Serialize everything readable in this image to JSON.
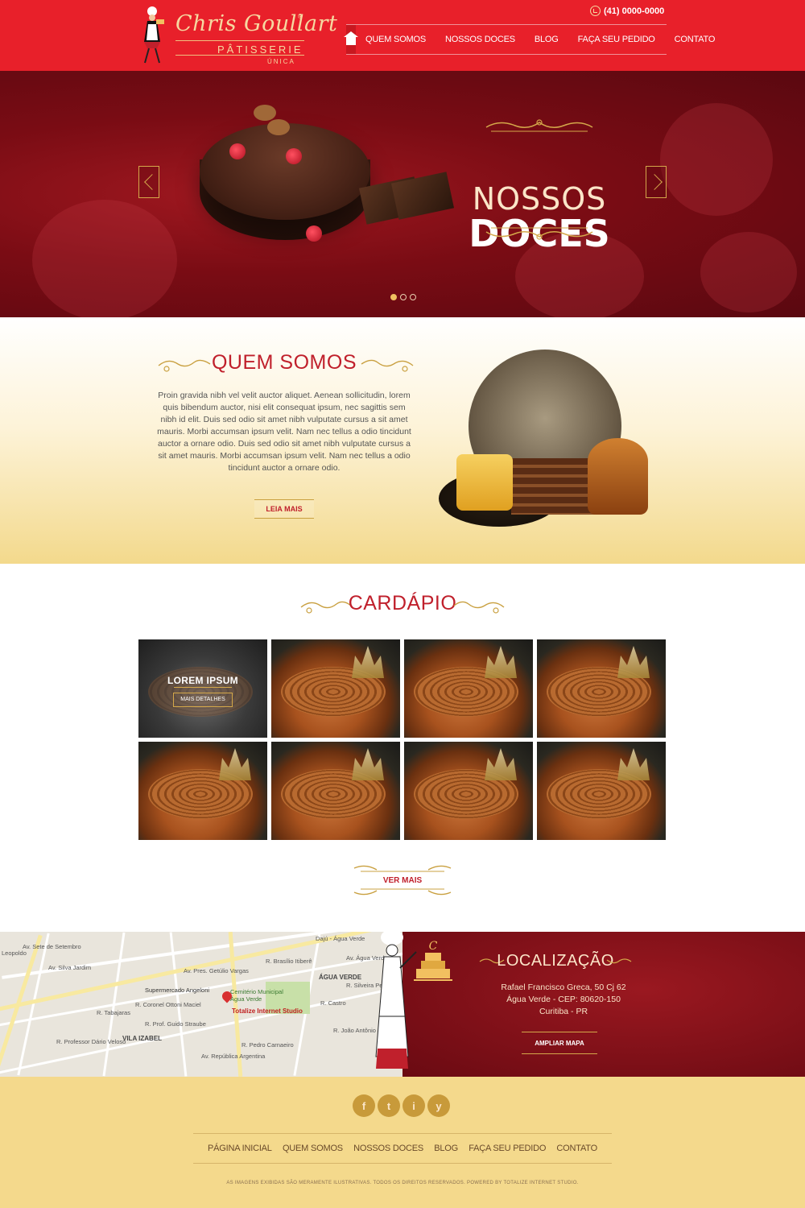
{
  "header": {
    "brand": "Chris Goullart",
    "brand_sub": "PÂTISSERIE",
    "brand_sub2": "ÚNICA",
    "registered": "®",
    "phone": "(41) 0000-0000",
    "nav": [
      "QUEM SOMOS",
      "NOSSOS DOCES",
      "BLOG",
      "FAÇA SEU PEDIDO",
      "CONTATO"
    ]
  },
  "hero": {
    "title_line1": "NOSSOS",
    "title_line2": "DOCES",
    "active_slide": 1,
    "slides": 3
  },
  "about": {
    "title": "QUEM SOMOS",
    "text": "Proin gravida nibh vel velit auctor aliquet. Aenean sollicitudin, lorem quis bibendum auctor, nisi elit consequat ipsum, nec sagittis sem nibh id elit. Duis sed odio sit amet nibh vulputate cursus a sit amet mauris. Morbi accumsan ipsum velit. Nam nec tellus a odio tincidunt auctor a ornare odio. Duis sed odio sit amet nibh vulputate cursus a sit amet mauris. Morbi accumsan ipsum velit. Nam nec tellus a odio tincidunt auctor a ornare odio.",
    "button": "LEIA MAIS"
  },
  "menu": {
    "title": "CARDÁPIO",
    "first_tile_label": "LOREM IPSUM",
    "first_tile_button": "MAIS DETALHES",
    "more_button": "VER MAIS"
  },
  "location": {
    "title": "LOCALIZAÇÃO",
    "address_line1": "Rafael Francisco Greca, 50 Cj 62",
    "address_line2": "Água Verde - CEP: 80620-150",
    "address_line3": "Curitiba - PR",
    "button": "AMPLIAR MAPA",
    "map_labels": {
      "l1": "Dajú - Água Verde",
      "l2": "R. Brasílio Itiberê",
      "l3": "ÁGUA VERDE",
      "l4": "Supermercado Angeloni",
      "l5": "Cemitério Municipal Água Verde",
      "l6": "Totalize Internet Studio",
      "l7": "VILA IZABEL",
      "l8": "Av. Sete de Setembro",
      "l9": "R. Coronel Ottoni Maciel",
      "l10": "R. Professor Dário Veloso",
      "l11": "Av. Pres. Getúlio Vargas",
      "l12": "R. Silveira Peixoto",
      "l13": "R. João Antônio Xavier",
      "l14": "R. Castro",
      "l15": "Av. Água Verde",
      "l16": "Leopoldo",
      "l17": "Av. Silva Jardim",
      "l18": "R. Tabajaras",
      "l19": "R. Prof. Guido Straube",
      "l20": "Av. República Argentina",
      "l21": "R. Pedro Carnaeiro"
    }
  },
  "footer": {
    "social": [
      "f",
      "t",
      "i",
      "y"
    ],
    "nav": [
      "PÁGINA INICIAL",
      "QUEM SOMOS",
      "NOSSOS DOCES",
      "BLOG",
      "FAÇA SEU PEDIDO",
      "CONTATO"
    ],
    "copyright": "AS IMAGENS EXIBIDAS SÃO MERAMENTE ILUSTRATIVAS. TODOS OS DIREITOS RESERVADOS. POWERED BY TOTALIZE INTERNET STUDIO."
  },
  "colors": {
    "header_red": "#e8202a",
    "accent_red": "#c0202c",
    "gold": "#d4a84a",
    "footer_bg": "#f4d98c"
  }
}
